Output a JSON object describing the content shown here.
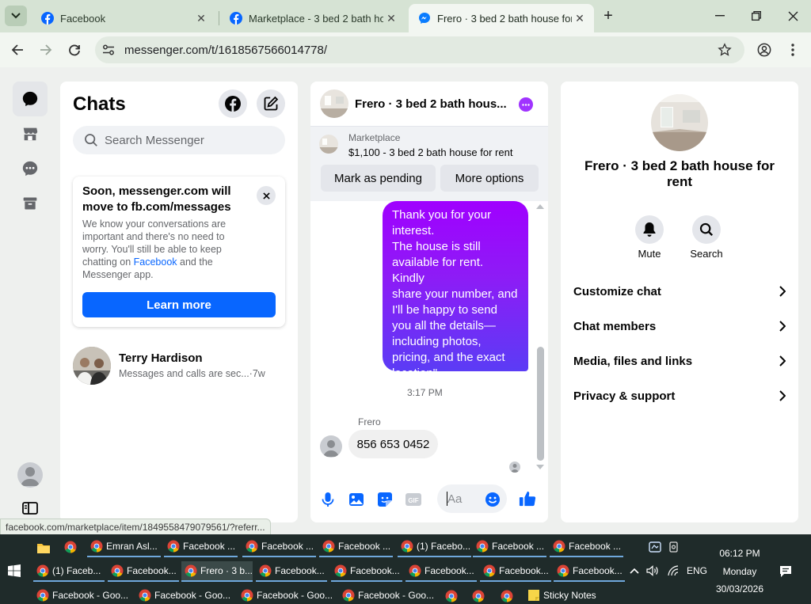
{
  "browser": {
    "tabs": [
      {
        "title": "Facebook",
        "active": false
      },
      {
        "title": "Marketplace - 3 bed 2 bath hou",
        "active": false
      },
      {
        "title": "Frero · 3 bed 2 bath house for r",
        "active": true
      }
    ],
    "url": "messenger.com/t/1618567566014778/",
    "status_url": "facebook.com/marketplace/item/1849558479079561/?referr..."
  },
  "colors": {
    "facebook_blue": "#0866ff",
    "messenger_purple": "#a033ff",
    "bubble_top": "#a000ff",
    "bubble_bottom": "#5b3cf5"
  },
  "chats": {
    "title": "Chats",
    "search_placeholder": "Search Messenger",
    "notice": {
      "title": "Soon, messenger.com will move to fb.com/messages",
      "body_before": "We know your conversations are important and there's no need to worry. You'll still be able to keep chatting on ",
      "body_link": "Facebook",
      "body_after": " and the Messenger app.",
      "button": "Learn more"
    },
    "items": [
      {
        "name": "Terry Hardison",
        "preview": "Messages and calls are sec...",
        "time": "·7w"
      }
    ]
  },
  "conversation": {
    "title": "Frero · 3 bed 2 bath hous...",
    "listing": {
      "label": "Marketplace",
      "detail": "$1,100 - 3 bed 2 bath house for rent"
    },
    "actions": {
      "pending": "Mark as pending",
      "more": "More options"
    },
    "messages": [
      {
        "from": "me",
        "lines": [
          "Thank you for your",
          "interest.",
          "The house is still",
          "available for rent. Kindly",
          "share your number, and",
          "I'll be happy to send",
          "you all the details—",
          "including photos,",
          "pricing, and the exact",
          "location\""
        ]
      },
      {
        "from": "Frero",
        "text": "856 653 0452"
      }
    ],
    "timestamp": "3:17 PM",
    "composer_placeholder": "Aa"
  },
  "info": {
    "name": "Frero · 3 bed 2 bath house for rent",
    "buttons": {
      "mute": "Mute",
      "search": "Search"
    },
    "rows": [
      "Customize chat",
      "Chat members",
      "Media, files and links",
      "Privacy & support"
    ]
  },
  "taskbar": {
    "row1": [
      "Emran Asl...",
      "Facebook ...",
      "Facebook ...",
      "Facebook ...",
      "(1) Facebo...",
      "Facebook ...",
      "Facebook ..."
    ],
    "row2": [
      "(1) Faceb...",
      "Facebook...",
      "Frero · 3 b...",
      "Facebook...",
      "Facebook...",
      "Facebook...",
      "Facebook...",
      "Facebook..."
    ],
    "row3": [
      "Facebook - Goo...",
      "Facebook - Goo...",
      "Facebook - Goo...",
      "Facebook - Goo...",
      "Sticky Notes"
    ],
    "lang": "ENG",
    "time": "06:12 PM",
    "day": "Monday",
    "date": "30/03/2026"
  }
}
